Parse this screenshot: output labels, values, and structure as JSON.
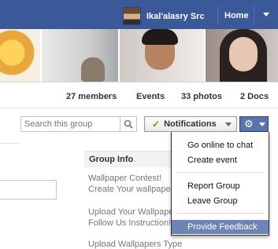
{
  "topbar": {
    "user_name": "Ikal'alasry Src",
    "home_label": "Home"
  },
  "group": {
    "stats": {
      "members": "27 members",
      "events": "Events",
      "photos": "33 photos",
      "docs": "2 Docs"
    }
  },
  "search": {
    "placeholder": "Search this group"
  },
  "notifications": {
    "label": "Notifications"
  },
  "settings_menu": {
    "items": [
      "Go online to chat",
      "Create event",
      "Report Group",
      "Leave Group",
      "Provide Feedback"
    ],
    "active_item": "Provide Feedback"
  },
  "group_info": {
    "title": "Group Info",
    "lines": [
      "Wallpaper Contest!",
      "Create Your wallpaper",
      "Upload Your Wallpaper",
      "Follow Us Instruction!",
      "Upload Wallpapers Type"
    ]
  },
  "colors": {
    "topbar": "#3b5998",
    "highlight": "#6d84b4",
    "check": "#5a9e2d"
  }
}
